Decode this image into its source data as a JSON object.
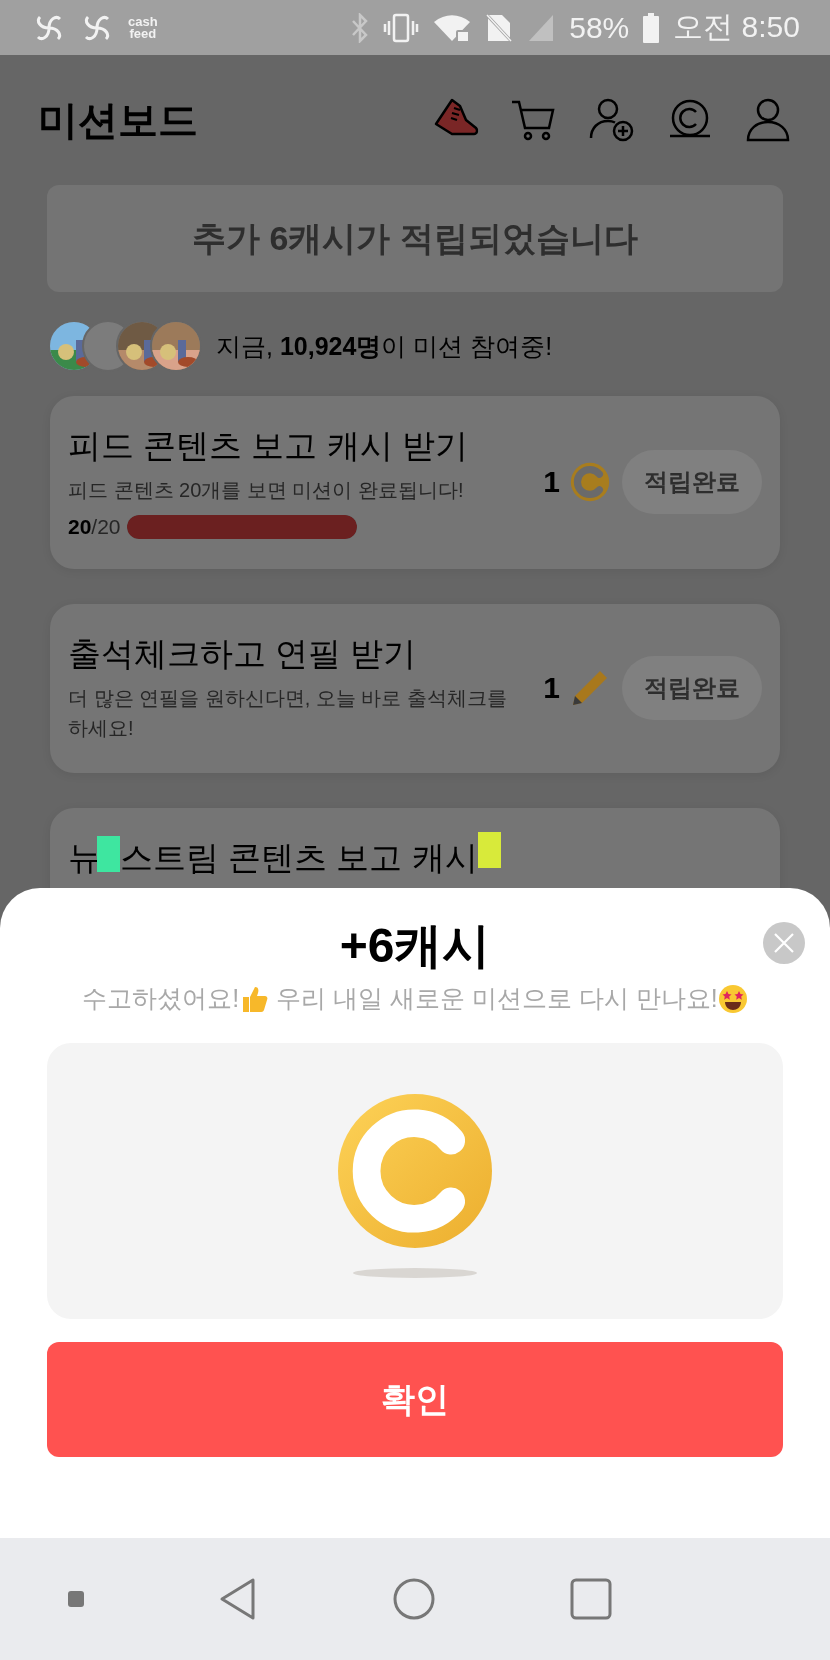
{
  "status_bar": {
    "app_logo": [
      "cash",
      "feed"
    ],
    "battery": "58%",
    "time": "오전 8:50"
  },
  "header": {
    "title": "미션보드"
  },
  "banner": {
    "text": "추가 6캐시가 적립되었습니다"
  },
  "participants": {
    "avatars": [
      {
        "kind": "picture"
      },
      {
        "kind": "default"
      },
      {
        "kind": "picture"
      },
      {
        "kind": "picture"
      }
    ],
    "text": "지금, **10,924명**이 미션 참여중!"
  },
  "missions": [
    {
      "title": "피드 콘텐츠 보고 캐시 받기",
      "description": "피드 콘텐츠 20개를 보면 미션이 완료됩니다!",
      "progress": {
        "done": "20",
        "total": "/20",
        "level": 1
      },
      "reward": {
        "kind": "coin",
        "amount": "1"
      },
      "button": "적립완료",
      "disabled": true
    },
    {
      "title": "출석체크하고 연필 받기",
      "description": "더 많은 연필을 원하신다면, 오늘 바로 출석체크를 하세요!",
      "reward": {
        "kind": "pencil",
        "amount": "1"
      },
      "button": "적립완료",
      "disabled": true
    },
    {
      "title_parts": [
        "뉴",
        "스트림 콘텐츠 보고 캐시"
      ]
    }
  ],
  "modal": {
    "title": "+6캐시",
    "message": [
      "수고하셨어요!",
      " 우리 내일 새로운 미션으로 다시 만나요!"
    ],
    "confirm": "확인"
  }
}
